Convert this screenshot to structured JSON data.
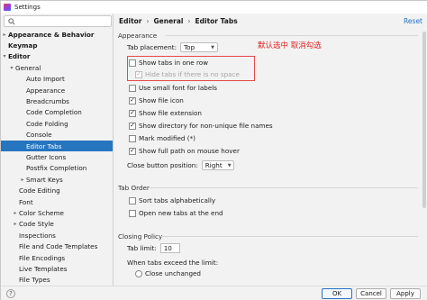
{
  "window": {
    "title": "Settings"
  },
  "search": {
    "placeholder": ""
  },
  "sidebar": {
    "items": [
      {
        "label": "Appearance & Behavior"
      },
      {
        "label": "Keymap"
      },
      {
        "label": "Editor"
      },
      {
        "label": "General"
      },
      {
        "label": "Auto Import"
      },
      {
        "label": "Appearance"
      },
      {
        "label": "Breadcrumbs"
      },
      {
        "label": "Code Completion"
      },
      {
        "label": "Code Folding"
      },
      {
        "label": "Console"
      },
      {
        "label": "Editor Tabs"
      },
      {
        "label": "Gutter Icons"
      },
      {
        "label": "Postfix Completion"
      },
      {
        "label": "Smart Keys"
      },
      {
        "label": "Code Editing"
      },
      {
        "label": "Font"
      },
      {
        "label": "Color Scheme"
      },
      {
        "label": "Code Style"
      },
      {
        "label": "Inspections"
      },
      {
        "label": "File and Code Templates"
      },
      {
        "label": "File Encodings"
      },
      {
        "label": "Live Templates"
      },
      {
        "label": "File Types"
      }
    ]
  },
  "breadcrumb": {
    "items": [
      "Editor",
      "General",
      "Editor Tabs"
    ]
  },
  "reset_label": "Reset",
  "appearance": {
    "title": "Appearance",
    "tab_placement_label": "Tab placement:",
    "tab_placement_value": "Top",
    "show_tabs_one_row": "Show tabs in one row",
    "hide_tabs_no_space": "Hide tabs if there is no space",
    "use_small_font": "Use small font for labels",
    "show_file_icon": "Show file icon",
    "show_file_extension": "Show file extension",
    "show_directory": "Show directory for non-unique file names",
    "mark_modified": "Mark modified (*)",
    "show_full_path": "Show full path on mouse hover",
    "close_button_position_label": "Close button position:",
    "close_button_position_value": "Right"
  },
  "annotation": "默认选中  取消勾选",
  "tab_order": {
    "title": "Tab Order",
    "sort_alphabetically": "Sort tabs alphabetically",
    "open_new_at_end": "Open new tabs at the end"
  },
  "closing_policy": {
    "title": "Closing Policy",
    "tab_limit_label": "Tab limit:",
    "tab_limit_value": "10",
    "exceed_label": "When tabs exceed the limit:",
    "close_unchanged": "Close unchanged"
  },
  "footer": {
    "ok": "OK",
    "cancel": "Cancel",
    "apply": "Apply",
    "help": "?"
  },
  "colors": {
    "accent": "#2675bf",
    "annotation": "#e02020",
    "link": "#2470c8"
  }
}
